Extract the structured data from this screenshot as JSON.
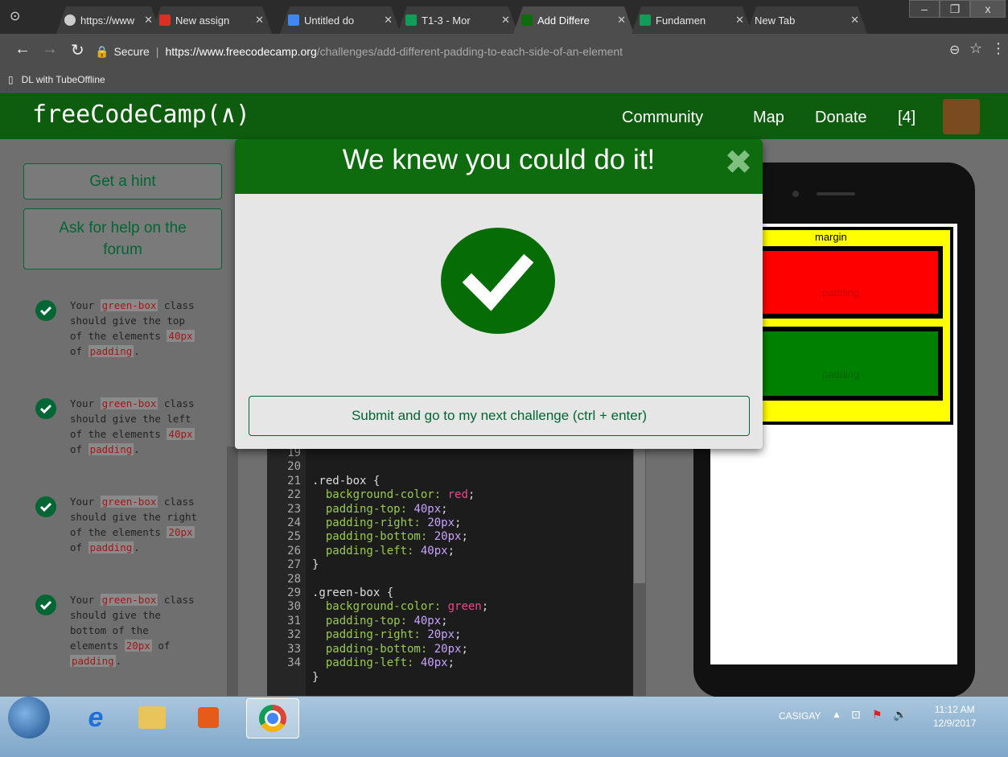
{
  "browser": {
    "tabs": [
      {
        "label": "https://www",
        "color": "#cccccc"
      },
      {
        "label": "New assign",
        "color": "#d93025"
      },
      {
        "label": "Untitled do",
        "color": "#4285f4"
      },
      {
        "label": "T1-3 - Mor",
        "color": "#0f9d58"
      },
      {
        "label": "Add Differe",
        "color": "#0e6b0e"
      },
      {
        "label": "Fundamen",
        "color": "#0f9d58"
      },
      {
        "label": "New Tab",
        "color": ""
      }
    ],
    "secure_label": "Secure",
    "url_host": "https://www.freecodecamp.org",
    "url_path": "/challenges/add-different-padding-to-each-side-of-an-element",
    "bookmark": "DL with TubeOffline",
    "window_controls": [
      "–",
      "❐",
      "x"
    ]
  },
  "fcc": {
    "logo": "freeCodeCamp(∧)",
    "nav": [
      "Community",
      "Map",
      "Donate",
      "[4]"
    ],
    "hint_button": "Get a hint",
    "forum_button_line1": "Ask for help on the",
    "forum_button_line2": "forum",
    "tests": [
      {
        "pre": "Your ",
        "tag": "green-box",
        "mid": " class should give the top of the elements ",
        "val": "40px",
        "post": " of ",
        "end": "padding",
        "dot": "."
      },
      {
        "pre": "Your ",
        "tag": "green-box",
        "mid": " class should give the left of the elements ",
        "val": "40px",
        "post": " of ",
        "end": "padding",
        "dot": "."
      },
      {
        "pre": "Your ",
        "tag": "green-box",
        "mid": " class should give the right of the elements ",
        "val": "20px",
        "post": " of ",
        "end": "padding",
        "dot": "."
      },
      {
        "pre": "Your ",
        "tag": "green-box",
        "mid": " class should give the bottom of the elements ",
        "val": "20px",
        "post": " of ",
        "end": "padding",
        "dot": "."
      }
    ],
    "line_numbers": [
      "19",
      "20",
      "21",
      "22",
      "23",
      "24",
      "25",
      "26",
      "27",
      "28",
      "29",
      "30",
      "31",
      "32",
      "33",
      "34"
    ],
    "preview": {
      "margin_label": "margin",
      "padding_label_1": "padding",
      "padding_label_2": "padding"
    }
  },
  "modal": {
    "title": "We knew you could do it!",
    "close": "✖",
    "submit": "Submit and go to my next challenge (ctrl + enter)"
  },
  "taskbar": {
    "user": "CASIGAY",
    "time": "11:12 AM",
    "date": "12/9/2017"
  }
}
